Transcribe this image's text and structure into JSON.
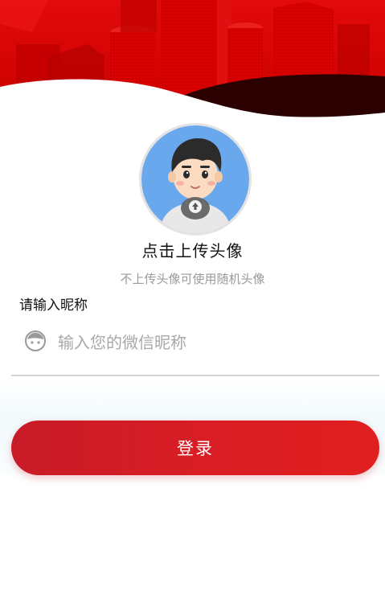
{
  "avatar": {
    "upload_title": "点击上传头像",
    "upload_hint": "不上传头像可使用随机头像"
  },
  "nickname": {
    "label": "请输入昵称",
    "placeholder": "输入您的微信昵称",
    "value": ""
  },
  "login_button": {
    "label": "登录"
  },
  "colors": {
    "brand_red": "#d81d24",
    "banner_dark": "#2a0000",
    "hint_gray": "#9a9a9a",
    "avatar_bg": "#6aa8ee"
  }
}
